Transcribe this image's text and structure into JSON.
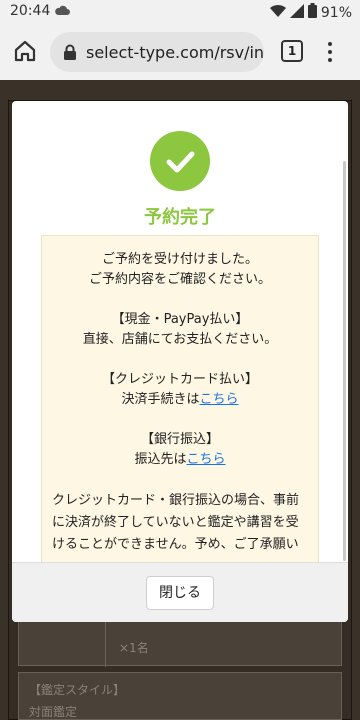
{
  "status_bar": {
    "time": "20:44",
    "battery": "91%"
  },
  "browser": {
    "url": "select-type.com/rsv/inde",
    "tab_count": "1"
  },
  "background_page": {
    "cell_text": "×1名",
    "style_heading": "【鑑定スタイル】",
    "style_value": "対面鑑定"
  },
  "modal": {
    "title": "予約完了",
    "lines": {
      "intro_1": "ご予約を受け付けました。",
      "intro_2": "ご予約内容をご確認ください。",
      "cash_heading": "【現金・PayPay払い】",
      "cash_text": "直接、店舗にてお支払ください。",
      "card_heading": "【クレジットカード払い】",
      "card_text": "決済手続きは",
      "card_link": "こちら",
      "bank_heading": "【銀行振込】",
      "bank_text": "振込先は",
      "bank_link": "こちら",
      "note": "クレジットカード・銀行振込の場合、事前に決済が終了していないと鑑定や講習を受けることができません。予め、ご了承願い"
    },
    "close_label": "閉じる"
  },
  "colors": {
    "accent_green": "#8dc63f",
    "link_blue": "#1a73e8",
    "message_bg": "#fdf7e3"
  }
}
